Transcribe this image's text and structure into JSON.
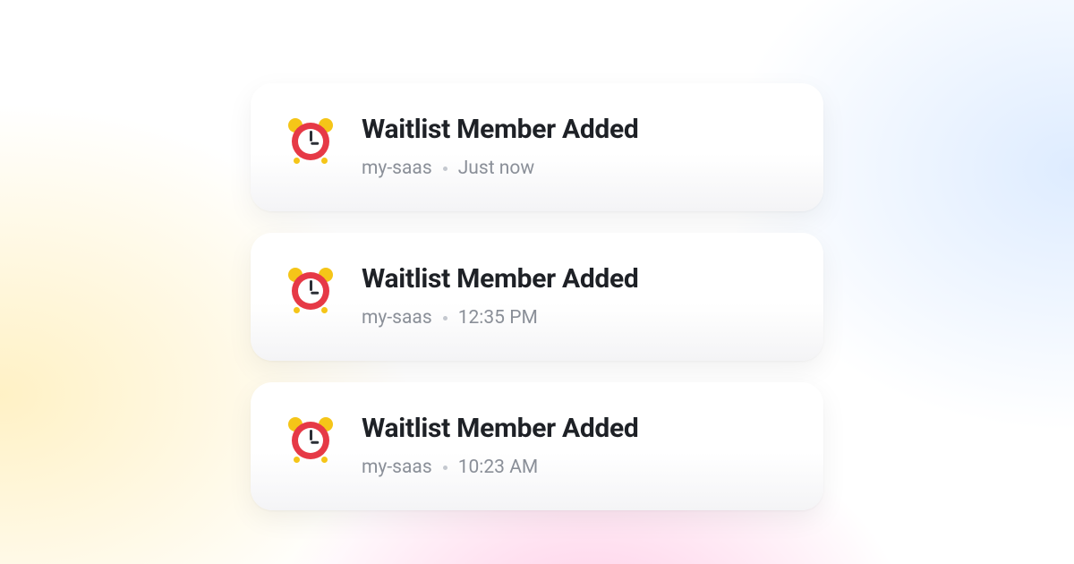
{
  "notifications": [
    {
      "title": "Waitlist Member Added",
      "source": "my-saas",
      "time": "Just now"
    },
    {
      "title": "Waitlist Member Added",
      "source": "my-saas",
      "time": "12:35 PM"
    },
    {
      "title": "Waitlist Member Added",
      "source": "my-saas",
      "time": "10:23 AM"
    }
  ]
}
